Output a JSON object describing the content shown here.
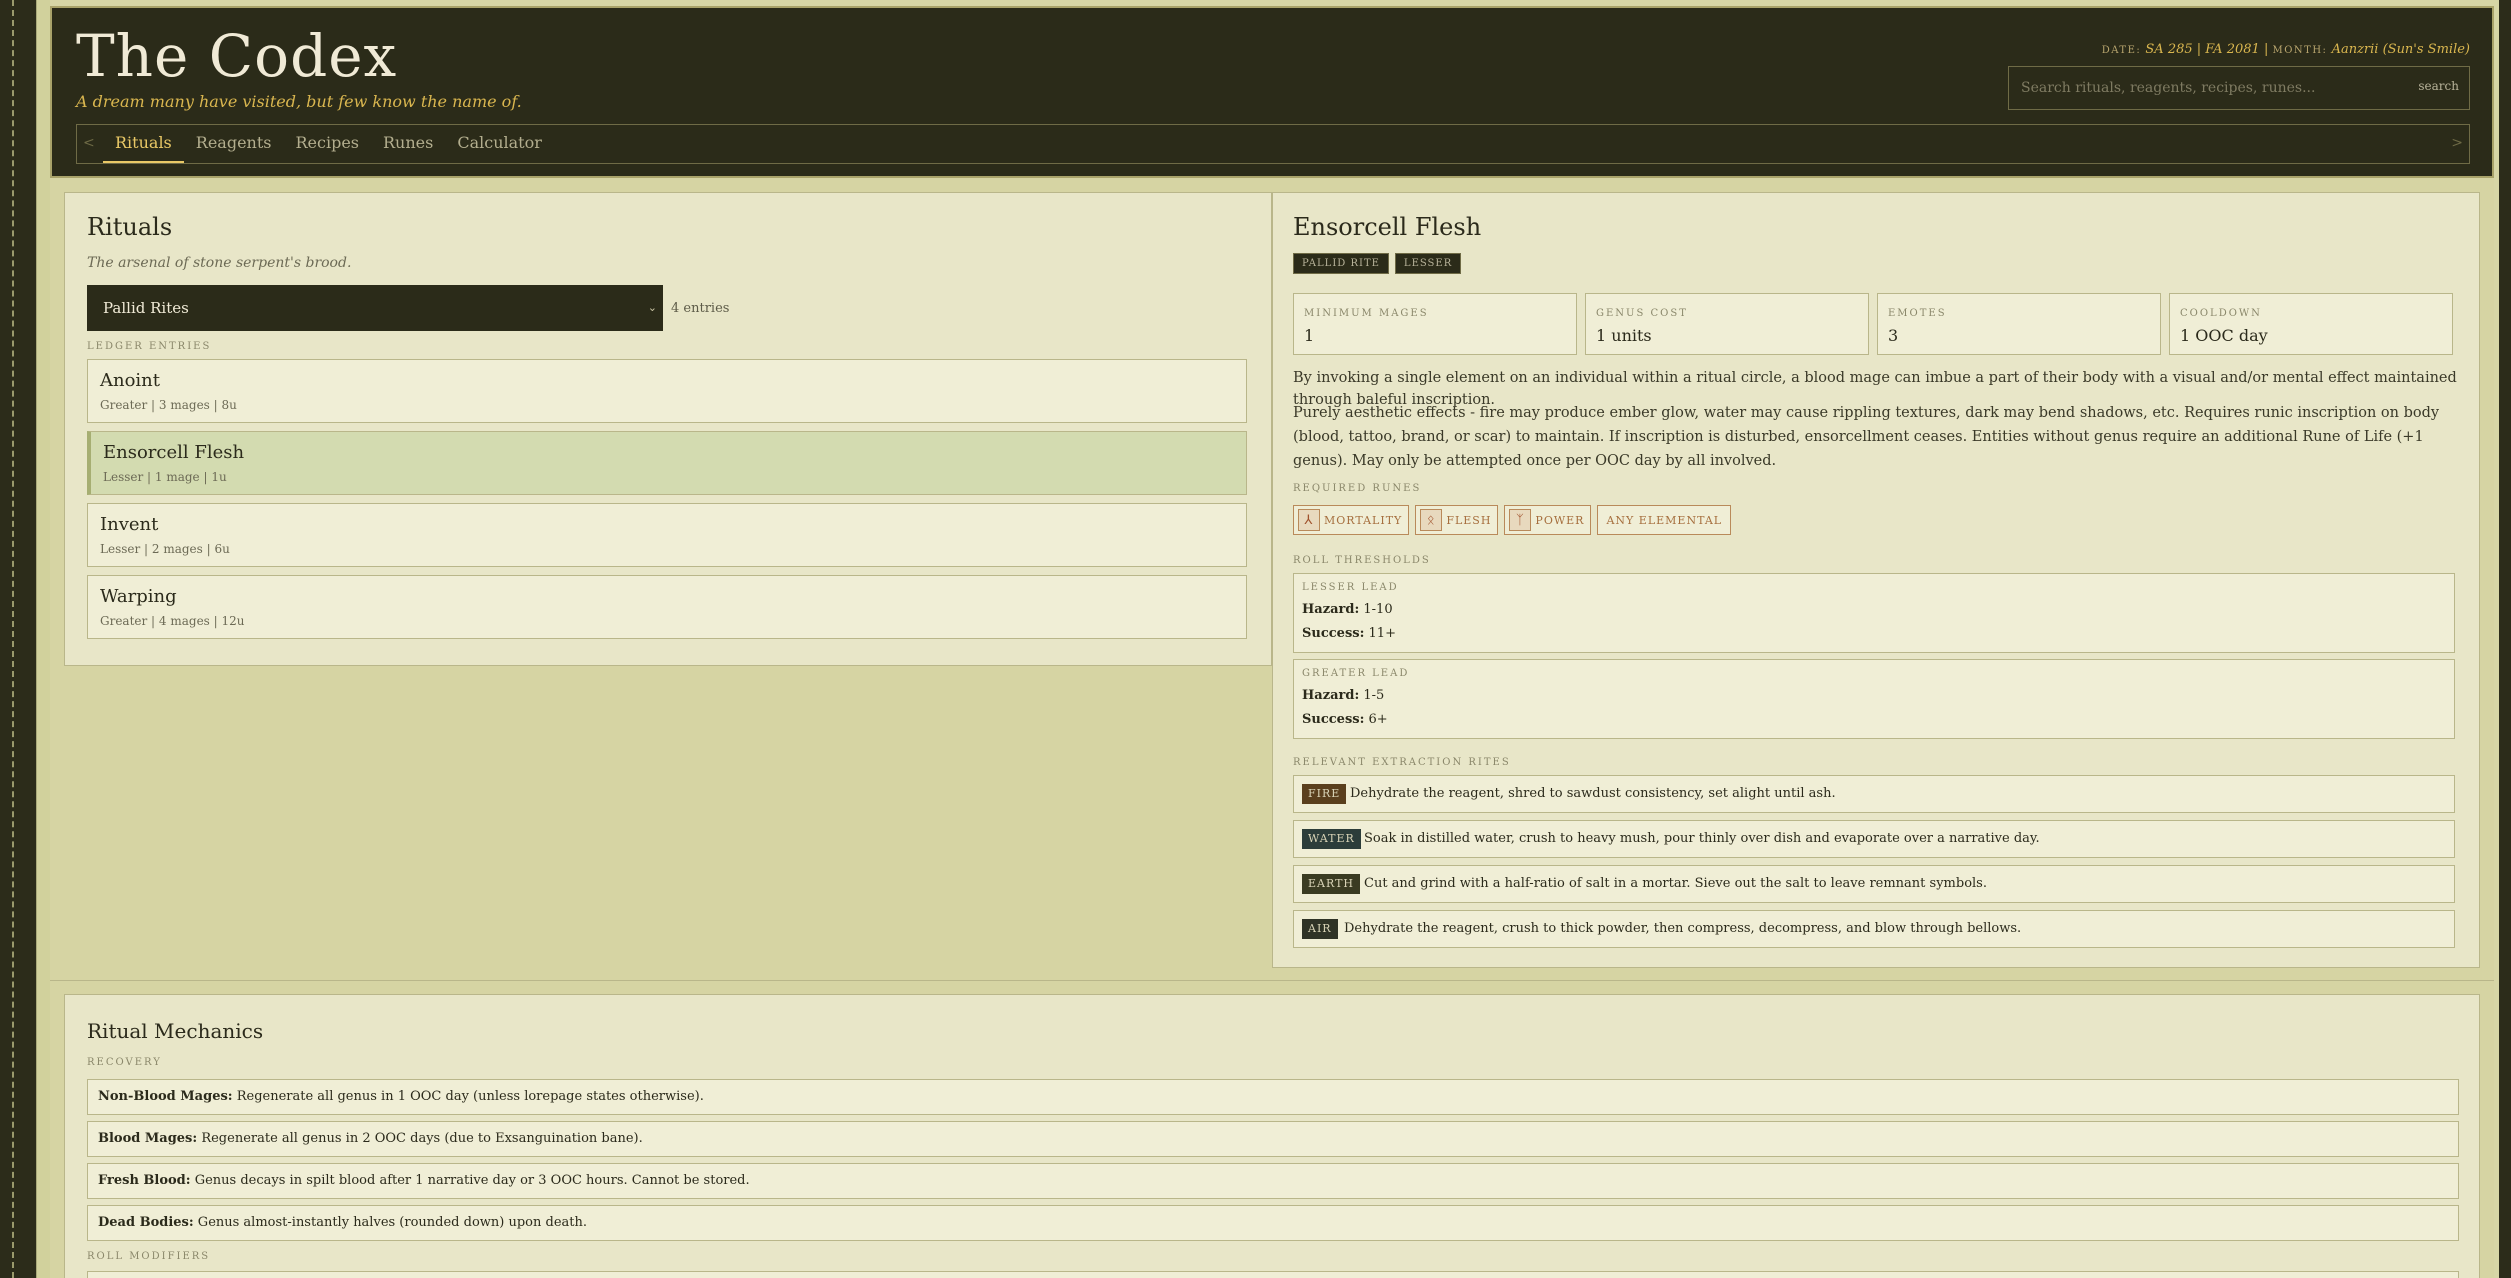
{
  "header": {
    "title": "The Codex",
    "tagline": "A dream many have visited, but few know the name of.",
    "date_label": "DATE:",
    "date_value": "SA 285 | FA 2081",
    "month_label": "MONTH:",
    "month_value": "Aanzrii (Sun's Smile)",
    "search_placeholder": "Search rituals, reagents, recipes, runes...",
    "search_button": "search"
  },
  "nav": {
    "prev": "<",
    "next": ">",
    "tabs": [
      "Rituals",
      "Reagents",
      "Recipes",
      "Runes",
      "Calculator"
    ],
    "active_tab": "Rituals"
  },
  "list_panel": {
    "title": "Rituals",
    "subtitle": "The arsenal of stone serpent's brood.",
    "category_select": "Pallid Rites",
    "entry_count": "4 entries",
    "ledger_label": "LEDGER ENTRIES",
    "entries": [
      {
        "name": "Anoint",
        "meta": "Greater | 3 mages | 8u"
      },
      {
        "name": "Ensorcell Flesh",
        "meta": "Lesser | 1 mage | 1u"
      },
      {
        "name": "Invent",
        "meta": "Lesser | 2 mages | 6u"
      },
      {
        "name": "Warping",
        "meta": "Greater | 4 mages | 12u"
      }
    ],
    "selected_entry": "Ensorcell Flesh"
  },
  "detail": {
    "title": "Ensorcell Flesh",
    "badges": [
      "PALLID RITE",
      "LESSER"
    ],
    "stats": [
      {
        "label": "MINIMUM MAGES",
        "value": "1"
      },
      {
        "label": "GENUS COST",
        "value": "1 units"
      },
      {
        "label": "EMOTES",
        "value": "3"
      },
      {
        "label": "COOLDOWN",
        "value": "1 OOC day"
      }
    ],
    "description": "By invoking a single element on an individual within a ritual circle, a blood mage can imbue a part of their body with a visual and/or mental effect maintained through baleful inscription.",
    "details": "Purely aesthetic effects - fire may produce ember glow, water may cause rippling textures, dark may bend shadows, etc. Requires runic inscription on body (blood, tattoo, brand, or scar) to maintain. If inscription is disturbed, ensorcellment ceases. Entities without genus require an additional Rune of Life (+1 genus). May only be attempted once per OOC day by all involved.",
    "runes_label": "REQUIRED RUNES",
    "runes": [
      {
        "name": "MORTALITY",
        "icon": "mortality-rune-icon",
        "glyph": "⅄"
      },
      {
        "name": "FLESH",
        "icon": "flesh-rune-icon",
        "glyph": "ᛟ"
      },
      {
        "name": "POWER",
        "icon": "power-rune-icon",
        "glyph": "ᛉ"
      },
      {
        "name": "ANY ELEMENTAL"
      }
    ],
    "thresholds_label": "ROLL THRESHOLDS",
    "thresholds": [
      {
        "label": "LESSER LEAD",
        "hazard_label": "Hazard:",
        "hazard": "1-10",
        "success_label": "Success:",
        "success": "11+"
      },
      {
        "label": "GREATER LEAD",
        "hazard_label": "Hazard:",
        "hazard": "1-5",
        "success_label": "Success:",
        "success": "6+"
      }
    ],
    "extraction_label": "RELEVANT EXTRACTION RITES",
    "extractions": [
      {
        "element": "FIRE",
        "color": "#5a3f1d",
        "text": "Dehydrate the reagent, shred to sawdust consistency, set alight until ash."
      },
      {
        "element": "WATER",
        "color": "#2c3d3a",
        "text": "Soak in distilled water, crush to heavy mush, pour thinly over dish and evaporate over a narrative day."
      },
      {
        "element": "EARTH",
        "color": "#3a3b22",
        "text": "Cut and grind with a half-ratio of salt in a mortar. Sieve out the salt to leave remnant symbols."
      },
      {
        "element": "AIR",
        "color": "#2f3326",
        "text": "Dehydrate the reagent, crush to thick powder, then compress, decompress, and blow through bellows."
      }
    ]
  },
  "mechanics": {
    "title": "Ritual Mechanics",
    "recovery_label": "RECOVERY",
    "rows": [
      {
        "label": "Non-Blood Mages:",
        "text": " Regenerate all genus in 1 OOC day (unless lorepage states otherwise)."
      },
      {
        "label": "Blood Mages:",
        "text": " Regenerate all genus in 2 OOC days (due to Exsanguination bane)."
      },
      {
        "label": "Fresh Blood:",
        "text": " Genus decays in spilt blood after 1 narrative day or 3 OOC hours. Cannot be stored."
      },
      {
        "label": "Dead Bodies:",
        "text": " Genus almost-instantly halves (rounded down) upon death."
      }
    ],
    "modifiers_label": "ROLL MODIFIERS"
  }
}
